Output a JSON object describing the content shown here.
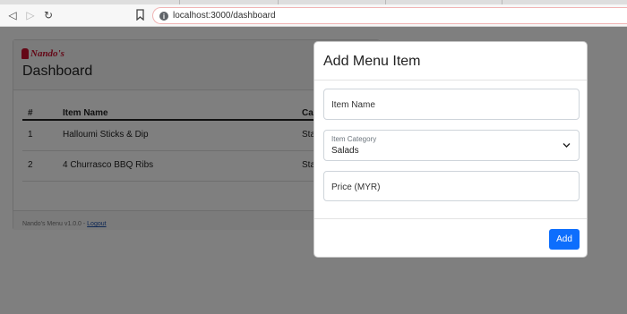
{
  "browser": {
    "url": "localhost:3000/dashboard",
    "nav": {
      "back": "◁",
      "forward": "▷",
      "reload": "↻"
    }
  },
  "page": {
    "logo_text": "Nando's",
    "title": "Dashboard",
    "table": {
      "headers": [
        "#",
        "Item Name",
        "Ca"
      ],
      "rows": [
        [
          "1",
          "Halloumi Sticks & Dip",
          "Sta"
        ],
        [
          "2",
          "4 Churrasco BBQ Ribs",
          "Sta"
        ]
      ]
    },
    "footer": {
      "text": "Nando's Menu v1.0.0 - ",
      "logout": "Logout"
    }
  },
  "modal": {
    "title": "Add Menu Item",
    "item_name_placeholder": "Item Name",
    "category_label": "Item Category",
    "category_value": "Salads",
    "price_placeholder": "Price (MYR)",
    "add_label": "Add"
  },
  "icons": {
    "info": "i"
  },
  "colors": {
    "primary": "#0d6efd",
    "brand": "#c8102e"
  }
}
